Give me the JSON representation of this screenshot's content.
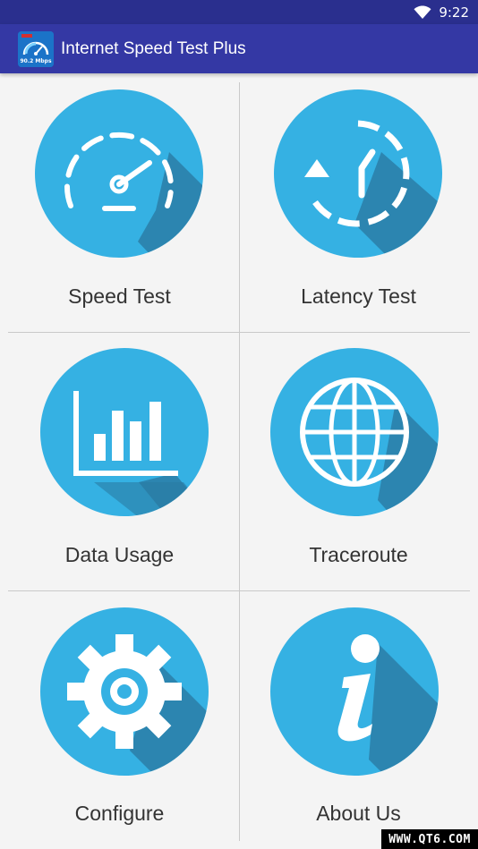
{
  "status_bar": {
    "time": "9:22",
    "wifi_icon": "wifi-icon"
  },
  "app_bar": {
    "title": "Internet Speed Test Plus",
    "icon": "speedometer-app-icon",
    "icon_text": "90.2 Mbps"
  },
  "menu": [
    {
      "label": "Speed Test",
      "icon": "speedometer-icon"
    },
    {
      "label": "Latency Test",
      "icon": "clock-refresh-icon"
    },
    {
      "label": "Data Usage",
      "icon": "bar-chart-icon"
    },
    {
      "label": "Traceroute",
      "icon": "globe-icon"
    },
    {
      "label": "Configure",
      "icon": "gear-icon"
    },
    {
      "label": "About Us",
      "icon": "info-icon"
    }
  ],
  "watermark": "WWW.QT6.COM",
  "colors": {
    "status_bar": "#2a2f8e",
    "app_bar": "#3438a4",
    "circle": "#35b1e3",
    "shadow": "#2a7ba3",
    "background": "#f4f4f4"
  }
}
